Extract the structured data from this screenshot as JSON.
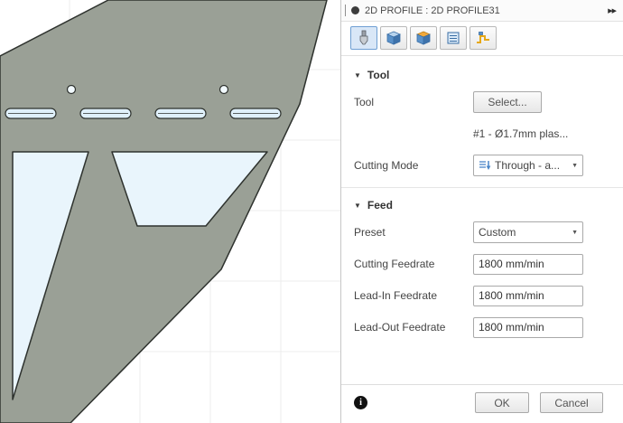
{
  "icons": {
    "collapse": "▶▶",
    "section_open": "▼",
    "dropdown": "▼",
    "info": "i"
  },
  "colors": {
    "part_fill": "#9aa096",
    "cutout_fill": "#e9f5fc",
    "outline": "#2e322e",
    "selected_tab": "#d9e7f7"
  },
  "panel": {
    "header": {
      "title": "2D PROFILE : 2D PROFILE31"
    },
    "tabs": [
      {
        "name": "tool"
      },
      {
        "name": "geometry"
      },
      {
        "name": "heights"
      },
      {
        "name": "passes"
      },
      {
        "name": "linking"
      }
    ],
    "tool_section": {
      "title": "Tool",
      "tool_label": "Tool",
      "select_button": "Select...",
      "tool_info": "#1 - Ø1.7mm plas...",
      "cutting_mode_label": "Cutting Mode",
      "cutting_mode_value": "Through - a..."
    },
    "feed_section": {
      "title": "Feed",
      "preset_label": "Preset",
      "preset_value": "Custom",
      "rows": [
        {
          "label": "Cutting Feedrate",
          "value": "1800 mm/min"
        },
        {
          "label": "Lead-In Feedrate",
          "value": "1800 mm/min"
        },
        {
          "label": "Lead-Out Feedrate",
          "value": "1800 mm/min"
        }
      ]
    },
    "footer": {
      "ok": "OK",
      "cancel": "Cancel"
    }
  }
}
